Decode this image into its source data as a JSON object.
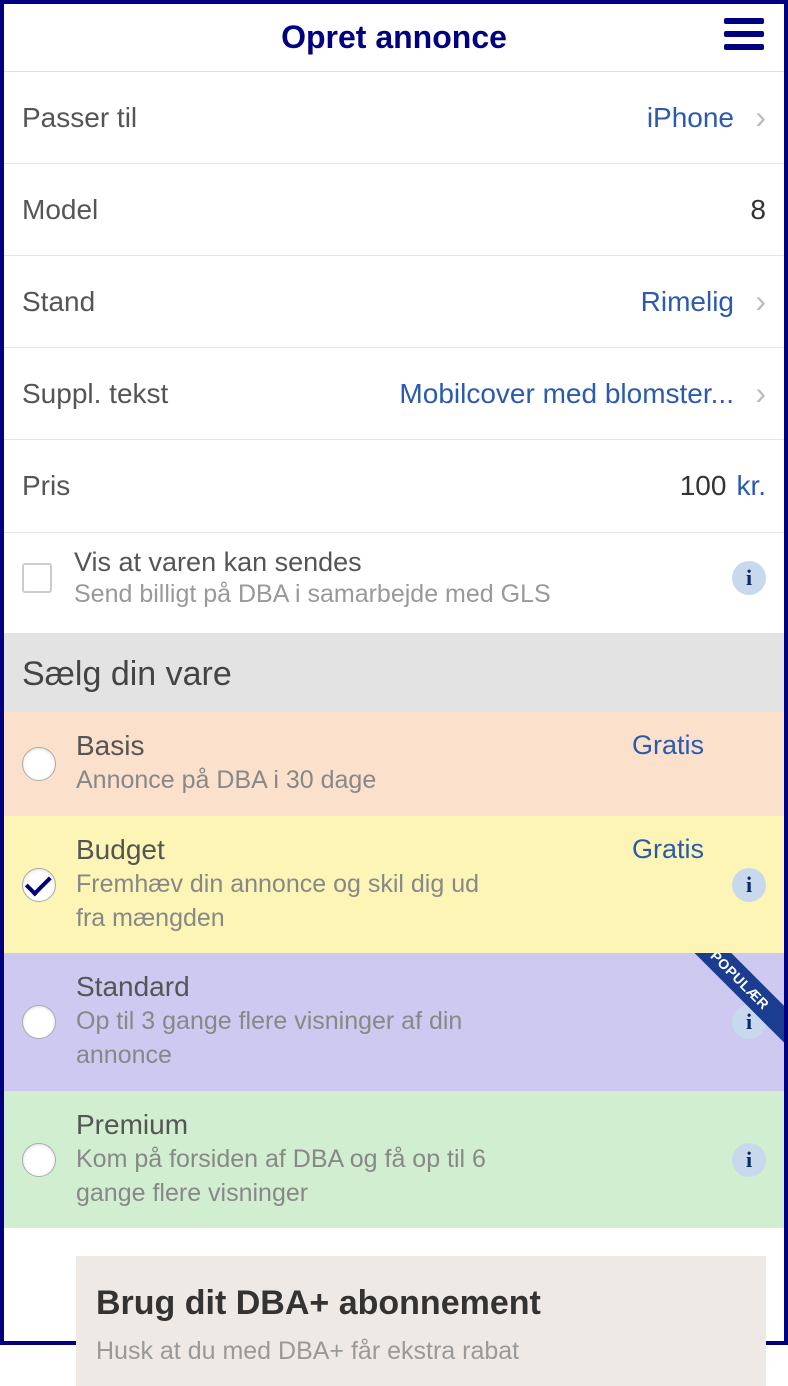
{
  "header": {
    "title": "Opret annonce"
  },
  "form": {
    "fits": {
      "label": "Passer til",
      "value": "iPhone"
    },
    "model": {
      "label": "Model",
      "value": "8"
    },
    "condition": {
      "label": "Stand",
      "value": "Rimelig"
    },
    "suppl": {
      "label": "Suppl. tekst",
      "value": "Mobilcover med blomster..."
    },
    "price": {
      "label": "Pris",
      "value": "100",
      "unit": "kr."
    }
  },
  "shipping": {
    "title": "Vis at varen kan sendes",
    "subtitle": "Send billigt på DBA i samarbejde med GLS"
  },
  "sell": {
    "heading": "Sælg din vare",
    "plans": {
      "basis": {
        "title": "Basis",
        "desc": "Annonce på DBA i 30 dage",
        "price": "Gratis"
      },
      "budget": {
        "title": "Budget",
        "desc": "Fremhæv din annonce og skil dig ud fra mængden",
        "price": "Gratis"
      },
      "standard": {
        "title": "Standard",
        "desc": "Op til 3 gange flere visninger af din annonce",
        "ribbon": "POPULÆR"
      },
      "premium": {
        "title": "Premium",
        "desc": "Kom på forsiden af DBA og få op til 6 gange flere visninger"
      }
    }
  },
  "dbaplus": {
    "title": "Brug dit DBA+ abonnement",
    "subtitle": "Husk at du med DBA+ får ekstra rabat"
  }
}
